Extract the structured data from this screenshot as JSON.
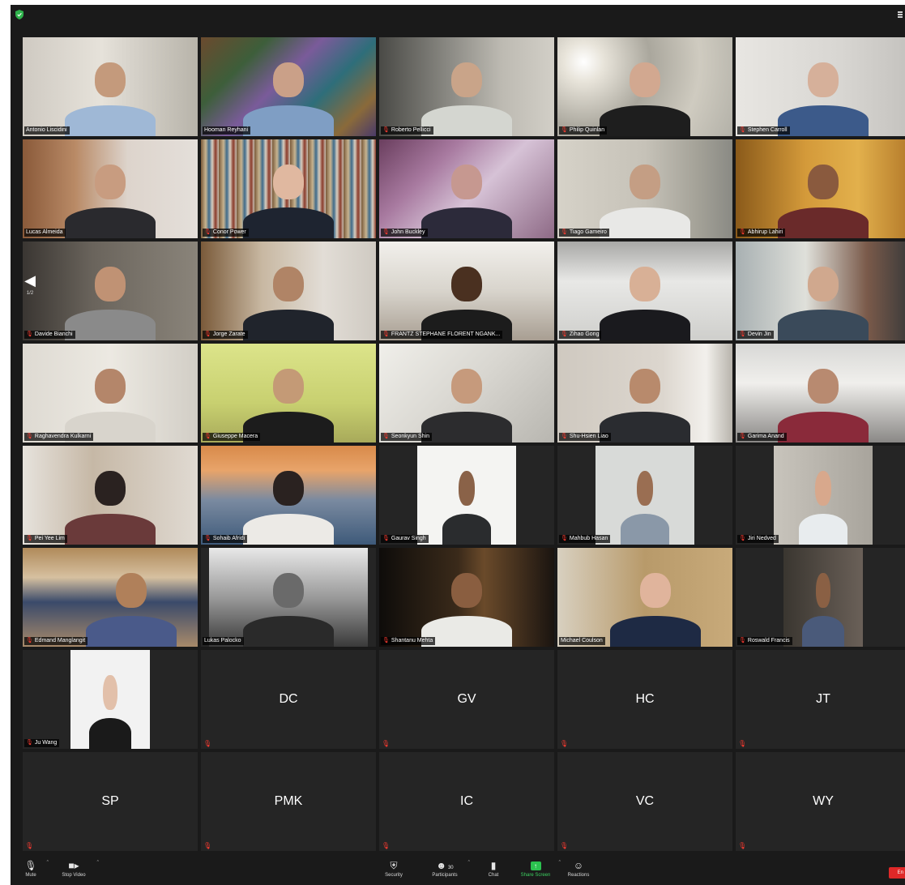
{
  "participants_with_video": [
    "Antonio Liscidini",
    "Hooman Reyhani",
    "Roberto Pellicci",
    "Philip Quinlan",
    "Stephen Carroll",
    "Lucas Almeida",
    "Conor Power",
    "John Buckley",
    "Tiago Gameiro",
    "Abhirup Lahiri",
    "Davide Bianchi",
    "Jorge Zarate",
    "FRANTZ STEPHANE FLORENT NGANK...",
    "Zihao Gong",
    "Devin Jin",
    "Raghavendra Kulkarni",
    "Giuseppe Macera",
    "Seonkyun Shin",
    "Shu-Hsien Liao",
    "Garima Anand",
    "Pei Yee Lim",
    "Sohaib Afridi",
    "Gaurav Singh",
    "Mahbub Hasan",
    "Jiri Nedved",
    "Edmand Manglangit",
    "Lukas Palocko",
    "Shantanu Mehta",
    "Michael Coulson",
    "Roswald Francis",
    "Ju Wang"
  ],
  "initials_tiles": [
    "DC",
    "GV",
    "HC",
    "JT",
    "SP",
    "PMK",
    "IC",
    "VC",
    "WY"
  ],
  "active_speaker": "Hooman Reyhani",
  "pagination": {
    "page": "1/2"
  },
  "toolbar": {
    "mute": "Mute",
    "stop_video": "Stop Video",
    "security": "Security",
    "participants": "Participants",
    "participants_count": "30",
    "chat": "Chat",
    "share_screen": "Share Screen",
    "reactions": "Reactions",
    "end": "En"
  },
  "colors": {
    "background": "#1a1a1a",
    "tile": "#252525",
    "speaker_outline": "#b5c94a",
    "muted_mic": "#ff3b30",
    "share_green": "#2bc24f",
    "end_red": "#e02828"
  },
  "icons": {
    "security": "shield-icon",
    "mute": "microphone-icon",
    "video": "video-camera-icon",
    "participants": "people-icon",
    "chat": "chat-bubble-icon",
    "share": "share-screen-arrow-icon",
    "reactions": "smiley-plus-icon"
  }
}
